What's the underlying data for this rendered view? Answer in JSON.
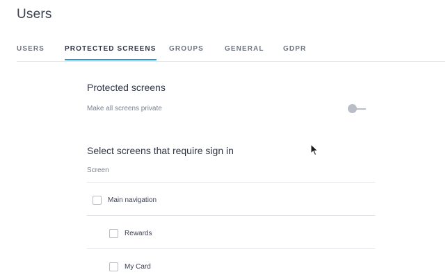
{
  "page": {
    "title": "Users"
  },
  "tabs": [
    {
      "label": "USERS",
      "active": false
    },
    {
      "label": "PROTECTED SCREENS",
      "active": true
    },
    {
      "label": "GROUPS",
      "active": false
    },
    {
      "label": "GENERAL",
      "active": false
    },
    {
      "label": "GDPR",
      "active": false
    }
  ],
  "protected": {
    "title": "Protected screens",
    "make_private_label": "Make all screens private",
    "make_private_enabled": false
  },
  "select": {
    "title": "Select screens that require sign in",
    "column_header": "Screen",
    "screens": [
      {
        "label": "Main navigation",
        "checked": false,
        "level": 0
      },
      {
        "label": "Rewards",
        "checked": false,
        "level": 1
      },
      {
        "label": "My Card",
        "checked": false,
        "level": 1
      }
    ]
  },
  "colors": {
    "accent": "#1f9ad6",
    "text": "#2f3544",
    "muted": "#7a808d",
    "toggle_off": "#b9bdc6",
    "divider": "#dfe2e6"
  },
  "icons": {
    "cursor": "mouse-pointer-icon",
    "checkbox": "checkbox-icon"
  }
}
